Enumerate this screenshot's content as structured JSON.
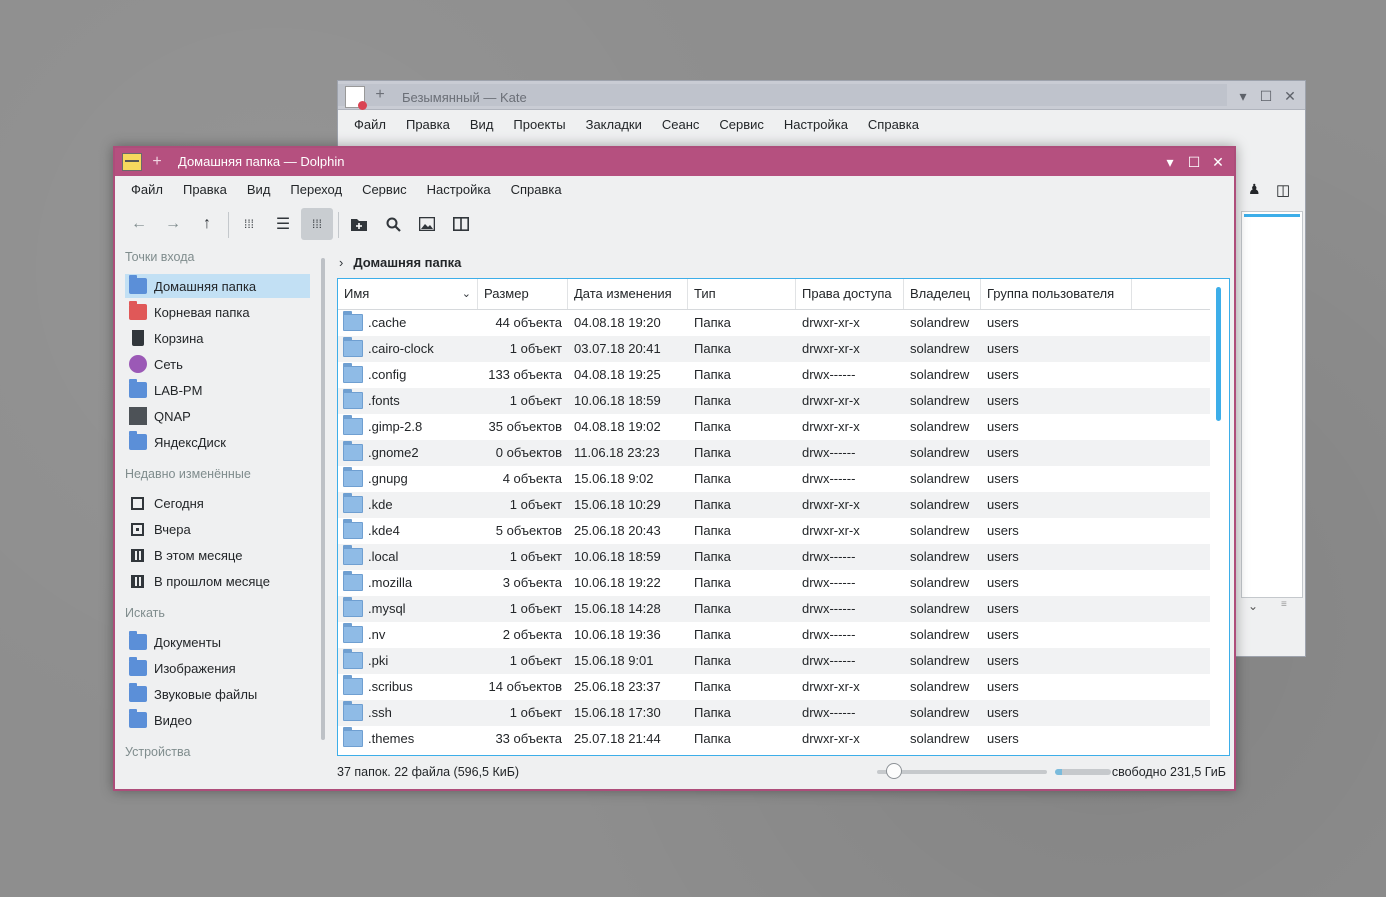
{
  "kate": {
    "title": "Безымянный — Kate",
    "menu": [
      "Файл",
      "Правка",
      "Вид",
      "Проекты",
      "Закладки",
      "Сеанс",
      "Сервис",
      "Настройка",
      "Справка"
    ]
  },
  "dolphin": {
    "title": "Домашняя папка — Dolphin",
    "menu": [
      "Файл",
      "Правка",
      "Вид",
      "Переход",
      "Сервис",
      "Настройка",
      "Справка"
    ],
    "breadcrumb": "Домашняя папка",
    "places": {
      "sections": [
        {
          "title": "Точки входа",
          "items": [
            {
              "label": "Домашняя папка",
              "icon": "home-folder-icon",
              "selected": true
            },
            {
              "label": "Корневая папка",
              "icon": "root-folder-icon"
            },
            {
              "label": "Корзина",
              "icon": "trash-icon"
            },
            {
              "label": "Сеть",
              "icon": "network-icon"
            },
            {
              "label": "LAB-PM",
              "icon": "network-folder-icon"
            },
            {
              "label": "QNAP",
              "icon": "nas-server-icon"
            },
            {
              "label": "ЯндексДиск",
              "icon": "cloud-folder-icon"
            }
          ]
        },
        {
          "title": "Недавно изменённые",
          "items": [
            {
              "label": "Сегодня",
              "icon": "calendar-day-icon"
            },
            {
              "label": "Вчера",
              "icon": "calendar-yesterday-icon"
            },
            {
              "label": "В этом месяце",
              "icon": "calendar-month-icon"
            },
            {
              "label": "В прошлом месяце",
              "icon": "calendar-last-month-icon"
            }
          ]
        },
        {
          "title": "Искать",
          "items": [
            {
              "label": "Документы",
              "icon": "documents-folder-icon"
            },
            {
              "label": "Изображения",
              "icon": "images-folder-icon"
            },
            {
              "label": "Звуковые файлы",
              "icon": "audio-folder-icon"
            },
            {
              "label": "Видео",
              "icon": "video-folder-icon"
            }
          ]
        },
        {
          "title": "Устройства",
          "items": []
        }
      ]
    },
    "columns": [
      "Имя",
      "Размер",
      "Дата изменения",
      "Тип",
      "Права доступа",
      "Владелец",
      "Группа пользователя"
    ],
    "files": [
      {
        "name": ".cache",
        "size": "44 объекта",
        "date": "04.08.18 19:20",
        "type": "Папка",
        "perms": "drwxr-xr-x",
        "owner": "solandrew",
        "group": "users"
      },
      {
        "name": ".cairo-clock",
        "size": "1 объект",
        "date": "03.07.18 20:41",
        "type": "Папка",
        "perms": "drwxr-xr-x",
        "owner": "solandrew",
        "group": "users"
      },
      {
        "name": ".config",
        "size": "133 объекта",
        "date": "04.08.18 19:25",
        "type": "Папка",
        "perms": "drwx------",
        "owner": "solandrew",
        "group": "users"
      },
      {
        "name": ".fonts",
        "size": "1 объект",
        "date": "10.06.18 18:59",
        "type": "Папка",
        "perms": "drwxr-xr-x",
        "owner": "solandrew",
        "group": "users"
      },
      {
        "name": ".gimp-2.8",
        "size": "35 объектов",
        "date": "04.08.18 19:02",
        "type": "Папка",
        "perms": "drwxr-xr-x",
        "owner": "solandrew",
        "group": "users"
      },
      {
        "name": ".gnome2",
        "size": "0 объектов",
        "date": "11.06.18 23:23",
        "type": "Папка",
        "perms": "drwx------",
        "owner": "solandrew",
        "group": "users"
      },
      {
        "name": ".gnupg",
        "size": "4 объекта",
        "date": "15.06.18 9:02",
        "type": "Папка",
        "perms": "drwx------",
        "owner": "solandrew",
        "group": "users"
      },
      {
        "name": ".kde",
        "size": "1 объект",
        "date": "15.06.18 10:29",
        "type": "Папка",
        "perms": "drwxr-xr-x",
        "owner": "solandrew",
        "group": "users"
      },
      {
        "name": ".kde4",
        "size": "5 объектов",
        "date": "25.06.18 20:43",
        "type": "Папка",
        "perms": "drwxr-xr-x",
        "owner": "solandrew",
        "group": "users"
      },
      {
        "name": ".local",
        "size": "1 объект",
        "date": "10.06.18 18:59",
        "type": "Папка",
        "perms": "drwx------",
        "owner": "solandrew",
        "group": "users"
      },
      {
        "name": ".mozilla",
        "size": "3 объекта",
        "date": "10.06.18 19:22",
        "type": "Папка",
        "perms": "drwx------",
        "owner": "solandrew",
        "group": "users"
      },
      {
        "name": ".mysql",
        "size": "1 объект",
        "date": "15.06.18 14:28",
        "type": "Папка",
        "perms": "drwx------",
        "owner": "solandrew",
        "group": "users"
      },
      {
        "name": ".nv",
        "size": "2 объекта",
        "date": "10.06.18 19:36",
        "type": "Папка",
        "perms": "drwx------",
        "owner": "solandrew",
        "group": "users"
      },
      {
        "name": ".pki",
        "size": "1 объект",
        "date": "15.06.18 9:01",
        "type": "Папка",
        "perms": "drwx------",
        "owner": "solandrew",
        "group": "users"
      },
      {
        "name": ".scribus",
        "size": "14 объектов",
        "date": "25.06.18 23:37",
        "type": "Папка",
        "perms": "drwxr-xr-x",
        "owner": "solandrew",
        "group": "users"
      },
      {
        "name": ".ssh",
        "size": "1 объект",
        "date": "15.06.18 17:30",
        "type": "Папка",
        "perms": "drwx------",
        "owner": "solandrew",
        "group": "users"
      },
      {
        "name": ".themes",
        "size": "33 объекта",
        "date": "25.07.18 21:44",
        "type": "Папка",
        "perms": "drwxr-xr-x",
        "owner": "solandrew",
        "group": "users"
      }
    ],
    "status": {
      "summary": "37 папок. 22 файла (596,5 КиБ)",
      "free_space": "свободно 231,5 ГиБ",
      "zoom_level": 0.05,
      "disk_used_fraction": 0.12
    },
    "colors": {
      "accent": "#3daee9",
      "titlebar": "#b5507f",
      "selection": "#c2e0f4"
    }
  }
}
